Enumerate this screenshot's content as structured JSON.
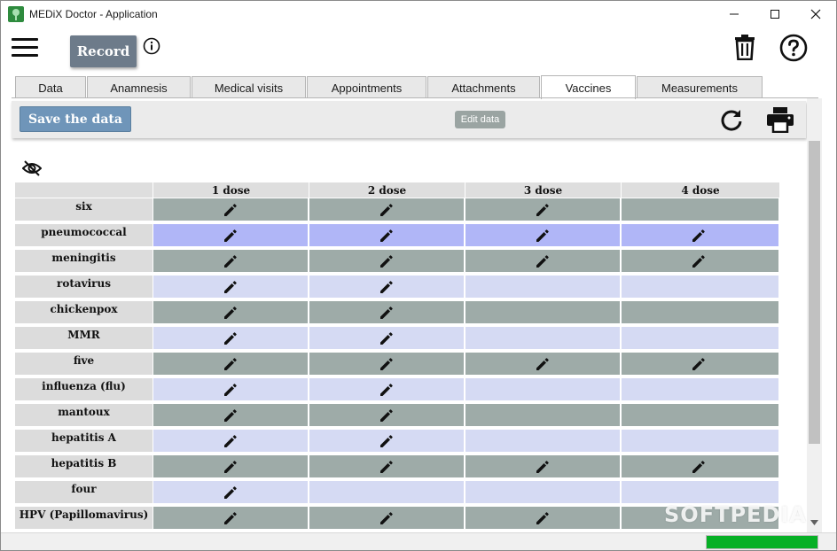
{
  "window": {
    "title": "MEDiX Doctor - Application"
  },
  "toolbar": {
    "record_label": "Record"
  },
  "tabs": [
    {
      "label": "Data"
    },
    {
      "label": "Anamnesis"
    },
    {
      "label": "Medical visits"
    },
    {
      "label": "Appointments"
    },
    {
      "label": "Attachments"
    },
    {
      "label": "Vaccines",
      "active": true
    },
    {
      "label": "Measurements"
    }
  ],
  "actions": {
    "save_label": "Save the data"
  },
  "table": {
    "columns": [
      "1 dose",
      "2 dose",
      "3 dose",
      "4 dose"
    ],
    "rows": [
      {
        "name": "six",
        "doses": [
          true,
          true,
          true,
          false
        ]
      },
      {
        "name": "pneumococcal",
        "doses": [
          true,
          true,
          true,
          true
        ],
        "selected": true
      },
      {
        "name": "meningitis",
        "doses": [
          true,
          true,
          true,
          true
        ]
      },
      {
        "name": "rotavirus",
        "doses": [
          true,
          true,
          false,
          false
        ]
      },
      {
        "name": "chickenpox",
        "doses": [
          true,
          true,
          false,
          false
        ]
      },
      {
        "name": "MMR",
        "doses": [
          true,
          true,
          false,
          false
        ]
      },
      {
        "name": "five",
        "doses": [
          true,
          true,
          true,
          true
        ]
      },
      {
        "name": "influenza (flu)",
        "doses": [
          true,
          true,
          false,
          false
        ]
      },
      {
        "name": "mantoux",
        "doses": [
          true,
          true,
          false,
          false
        ]
      },
      {
        "name": "hepatitis A",
        "doses": [
          true,
          true,
          false,
          false
        ]
      },
      {
        "name": "hepatitis B",
        "doses": [
          true,
          true,
          true,
          true
        ]
      },
      {
        "name": "four",
        "doses": [
          true,
          false,
          false,
          false
        ]
      },
      {
        "name": "HPV (Papillomavirus)",
        "doses": [
          true,
          true,
          true,
          false
        ]
      }
    ]
  },
  "tooltip": {
    "text": "Edit data"
  },
  "status": {
    "progress": 1.0
  },
  "watermark": "SOFTPEDIA",
  "icons": {
    "menu": "hamburger-icon",
    "info": "info-icon",
    "delete": "trash-icon",
    "help": "help-icon",
    "refresh": "refresh-icon",
    "print": "printer-icon",
    "visibility": "eye-off-icon",
    "edit": "pencil-icon"
  },
  "colors": {
    "record_button": "#6d7b8a",
    "save_button": "#6f95b9",
    "row_dark": "#9eaba8",
    "row_light": "#d5daf3",
    "row_selected": "#b0b6f7",
    "progress": "#06b025"
  }
}
